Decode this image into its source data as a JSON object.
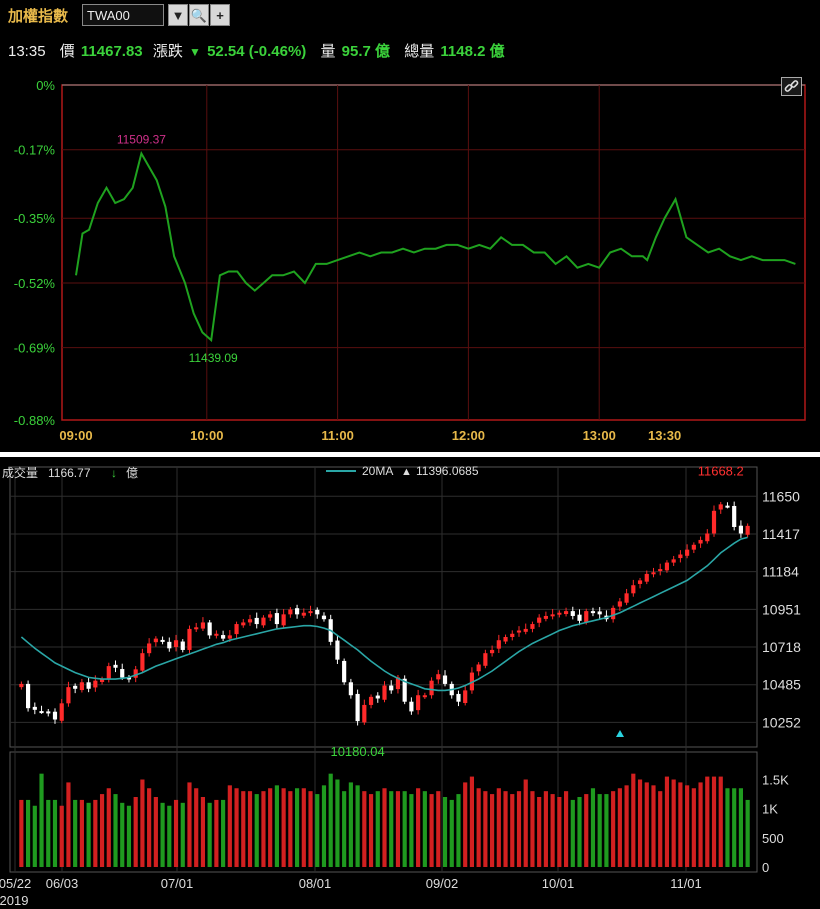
{
  "header": {
    "title": "加權指數",
    "symbol": "TWA00",
    "dropdown_icon": "▼",
    "search_icon": "🔍",
    "add_icon": "+"
  },
  "quote": {
    "time": "13:35",
    "price_label": "價",
    "price": "11467.83",
    "change_label": "漲跌",
    "change_arrow": "▼",
    "change": "52.54 (-0.46%)",
    "volume_label": "量",
    "volume": "95.7 億",
    "total_volume_label": "總量",
    "total_volume": "1148.2 億"
  },
  "colors": {
    "up": "#ff2a2a",
    "down": "#ffffff",
    "intraday_line": "#1fa21f",
    "ma": "#2aa6a6",
    "vol_up": "#d22020",
    "vol_down": "#1f9a1f"
  },
  "chart_data": [
    {
      "type": "line",
      "name": "intraday",
      "y_ticks": [
        "0%",
        "-0.17%",
        "-0.35%",
        "-0.52%",
        "-0.69%",
        "-0.88%"
      ],
      "y_tick_values": [
        0,
        -0.17,
        -0.35,
        -0.52,
        -0.69,
        -0.88
      ],
      "x_ticks": [
        "09:00",
        "10:00",
        "11:00",
        "12:00",
        "13:00",
        "13:30"
      ],
      "annotations": {
        "high": "11509.37",
        "low": "11439.09"
      },
      "ylim": [
        -0.88,
        0
      ],
      "x_minutes": [
        0,
        3,
        6,
        10,
        14,
        18,
        22,
        26,
        30,
        33,
        37,
        41,
        45,
        50,
        54,
        58,
        62,
        66,
        70,
        74,
        78,
        82,
        86,
        90,
        95,
        100,
        105,
        110,
        115,
        120,
        125,
        130,
        135,
        140,
        145,
        150,
        155,
        160,
        165,
        170,
        175,
        180,
        185,
        190,
        195,
        200,
        205,
        210,
        215,
        220,
        225,
        230,
        235,
        240,
        245,
        250,
        255,
        260,
        262,
        266,
        270,
        275,
        280,
        285,
        290,
        295,
        300,
        305,
        310,
        315,
        320,
        325,
        330
      ],
      "values": [
        -0.5,
        -0.39,
        -0.38,
        -0.31,
        -0.27,
        -0.31,
        -0.3,
        -0.27,
        -0.18,
        -0.21,
        -0.25,
        -0.32,
        -0.45,
        -0.52,
        -0.6,
        -0.65,
        -0.67,
        -0.5,
        -0.49,
        -0.49,
        -0.52,
        -0.54,
        -0.52,
        -0.5,
        -0.5,
        -0.49,
        -0.52,
        -0.47,
        -0.47,
        -0.46,
        -0.45,
        -0.44,
        -0.45,
        -0.44,
        -0.44,
        -0.43,
        -0.44,
        -0.43,
        -0.43,
        -0.42,
        -0.42,
        -0.43,
        -0.42,
        -0.43,
        -0.4,
        -0.42,
        -0.42,
        -0.44,
        -0.44,
        -0.47,
        -0.45,
        -0.48,
        -0.47,
        -0.48,
        -0.44,
        -0.43,
        -0.45,
        -0.45,
        -0.46,
        -0.4,
        -0.35,
        -0.3,
        -0.4,
        -0.42,
        -0.44,
        -0.43,
        -0.45,
        -0.46,
        -0.45,
        -0.46,
        -0.46,
        -0.46,
        -0.47
      ]
    },
    {
      "type": "candlestick",
      "name": "daily",
      "legend": {
        "volume_label": "成交量",
        "volume_value": "1166.77",
        "volume_arrow": "↓",
        "volume_unit": "億",
        "ma_label": "20MA",
        "ma_arrow": "▲",
        "ma_value": "11396.0685"
      },
      "y_ticks": [
        "11650",
        "11417",
        "11184",
        "10951",
        "10718",
        "10485",
        "10252"
      ],
      "y_tick_values": [
        11650,
        11417,
        11184,
        10951,
        10718,
        10485,
        10252
      ],
      "x_ticks": [
        "05/22",
        "06/03",
        "07/01",
        "08/01",
        "09/02",
        "10/01",
        "11/01"
      ],
      "x_tick_year": "2019",
      "annotations": {
        "high": "11668.2",
        "low": "10180.04"
      },
      "volume_ticks": [
        "1.5K",
        "1K",
        "500",
        "0"
      ],
      "ylim": [
        10100,
        11800
      ],
      "closes": [
        10490,
        10340,
        10330,
        10320,
        10310,
        10270,
        10370,
        10470,
        10460,
        10500,
        10460,
        10510,
        10520,
        10600,
        10590,
        10530,
        10520,
        10580,
        10680,
        10740,
        10770,
        10750,
        10710,
        10760,
        10700,
        10830,
        10840,
        10870,
        10790,
        10800,
        10770,
        10790,
        10860,
        10870,
        10890,
        10860,
        10900,
        10920,
        10860,
        10920,
        10950,
        10920,
        10930,
        10940,
        10920,
        10890,
        10750,
        10640,
        10500,
        10420,
        10260,
        10360,
        10410,
        10400,
        10480,
        10450,
        10530,
        10380,
        10320,
        10420,
        10420,
        10510,
        10550,
        10490,
        10420,
        10380,
        10450,
        10560,
        10610,
        10680,
        10700,
        10760,
        10780,
        10800,
        10820,
        10830,
        10860,
        10900,
        10910,
        10920,
        10930,
        10940,
        10910,
        10880,
        10940,
        10930,
        10920,
        10890,
        10960,
        11000,
        11050,
        11100,
        11130,
        11170,
        11180,
        11200,
        11240,
        11260,
        11290,
        11320,
        11350,
        11380,
        11420,
        11560,
        11600,
        11590,
        11460,
        11420,
        11467
      ],
      "ma20": [
        10780,
        10745,
        10710,
        10680,
        10650,
        10620,
        10600,
        10580,
        10560,
        10545,
        10530,
        10525,
        10520,
        10520,
        10520,
        10525,
        10530,
        10545,
        10560,
        10580,
        10600,
        10615,
        10630,
        10645,
        10660,
        10675,
        10690,
        10705,
        10720,
        10735,
        10745,
        10760,
        10770,
        10780,
        10790,
        10800,
        10810,
        10820,
        10830,
        10835,
        10840,
        10845,
        10850,
        10850,
        10845,
        10835,
        10820,
        10790,
        10760,
        10730,
        10700,
        10665,
        10630,
        10600,
        10570,
        10545,
        10525,
        10505,
        10490,
        10475,
        10460,
        10455,
        10450,
        10450,
        10455,
        10465,
        10480,
        10500,
        10520,
        10545,
        10570,
        10600,
        10630,
        10660,
        10690,
        10715,
        10740,
        10760,
        10780,
        10800,
        10820,
        10835,
        10850,
        10860,
        10870,
        10880,
        10890,
        10900,
        10915,
        10930,
        10950,
        10970,
        10990,
        11010,
        11030,
        11050,
        11070,
        11090,
        11110,
        11130,
        11160,
        11190,
        11220,
        11260,
        11300,
        11330,
        11360,
        11385,
        11396
      ],
      "volumes": [
        1150,
        1150,
        1050,
        1600,
        1150,
        1150,
        1050,
        1450,
        1150,
        1150,
        1100,
        1150,
        1250,
        1350,
        1250,
        1100,
        1050,
        1200,
        1500,
        1350,
        1200,
        1100,
        1050,
        1150,
        1100,
        1450,
        1350,
        1200,
        1100,
        1150,
        1150,
        1400,
        1350,
        1300,
        1300,
        1250,
        1300,
        1350,
        1400,
        1350,
        1300,
        1350,
        1350,
        1300,
        1250,
        1400,
        1600,
        1500,
        1300,
        1450,
        1400,
        1300,
        1250,
        1300,
        1350,
        1300,
        1300,
        1300,
        1250,
        1350,
        1300,
        1250,
        1300,
        1200,
        1150,
        1250,
        1450,
        1550,
        1350,
        1300,
        1250,
        1350,
        1300,
        1250,
        1300,
        1500,
        1300,
        1200,
        1300,
        1250,
        1200,
        1300,
        1150,
        1200,
        1250,
        1350,
        1250,
        1250,
        1300,
        1350,
        1400,
        1600,
        1500,
        1450,
        1400,
        1300,
        1550,
        1500,
        1450,
        1400,
        1350,
        1450,
        1550,
        1550,
        1550,
        1350,
        1350,
        1350,
        1150
      ],
      "volume_up": [
        1,
        0,
        0,
        0,
        0,
        0,
        1,
        1,
        0,
        1,
        0,
        1,
        1,
        1,
        0,
        0,
        0,
        1,
        1,
        1,
        1,
        0,
        0,
        1,
        0,
        1,
        1,
        1,
        0,
        1,
        0,
        1,
        1,
        1,
        1,
        0,
        1,
        1,
        0,
        1,
        1,
        0,
        1,
        1,
        0,
        0,
        0,
        0,
        0,
        0,
        0,
        1,
        1,
        0,
        1,
        0,
        1,
        0,
        0,
        1,
        0,
        1,
        1,
        0,
        0,
        0,
        1,
        1,
        1,
        1,
        1,
        1,
        1,
        1,
        1,
        1,
        1,
        1,
        1,
        1,
        1,
        1,
        0,
        0,
        1,
        0,
        0,
        0,
        1,
        1,
        1,
        1,
        1,
        1,
        1,
        1,
        1,
        1,
        1,
        1,
        1,
        1,
        1,
        1,
        1,
        0,
        0,
        0,
        0
      ]
    }
  ]
}
